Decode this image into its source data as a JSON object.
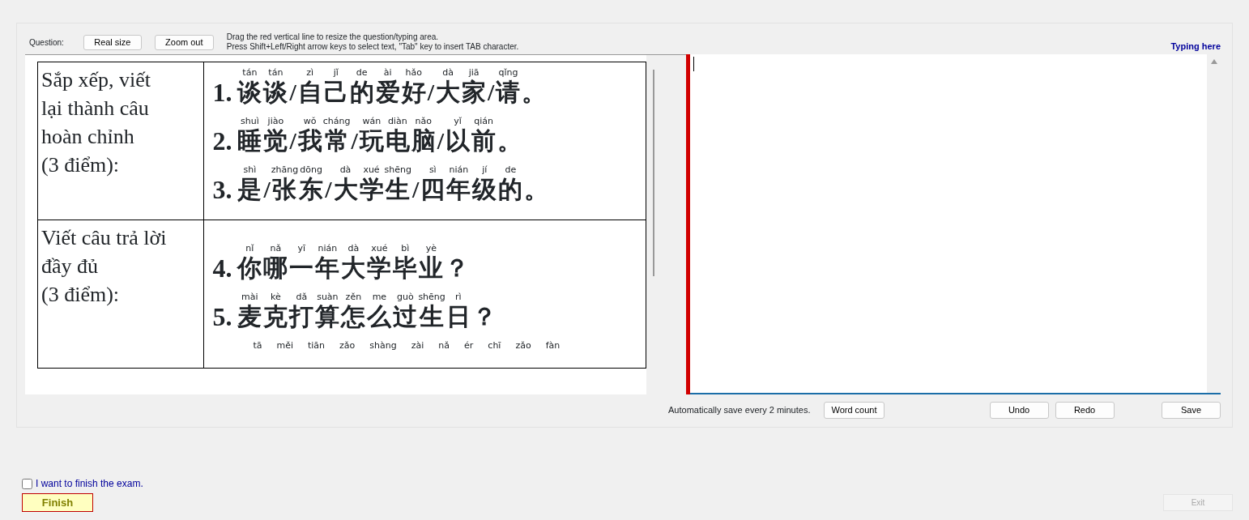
{
  "toolbar": {
    "label": "Question:",
    "buttons": [
      "Real size",
      "Zoom out"
    ],
    "hints": [
      "Drag the red vertical line to resize the question/typing area.",
      "Press Shift+Left/Right arrow keys to select text, \"Tab\" key to insert TAB character."
    ],
    "typing_label": "Typing here"
  },
  "document": {
    "rows": [
      {
        "label": "Sắp xếp, viết\nlại thành câu\nhoàn chỉnh\n(3 điểm):",
        "questions": [
          {
            "number": "1.",
            "chars": [
              {
                "py": "tán",
                "hz": "谈"
              },
              {
                "py": "tán",
                "hz": "谈"
              },
              {
                "hz": "/"
              },
              {
                "py": "zì",
                "hz": "自"
              },
              {
                "py": "jǐ",
                "hz": "己"
              },
              {
                "py": "de",
                "hz": "的"
              },
              {
                "py": "ài",
                "hz": "爱"
              },
              {
                "py": "hǎo",
                "hz": "好"
              },
              {
                "hz": "/"
              },
              {
                "py": "dà",
                "hz": "大"
              },
              {
                "py": "jiā",
                "hz": "家"
              },
              {
                "hz": "/"
              },
              {
                "py": "qǐng",
                "hz": "请"
              },
              {
                "hz": "。"
              }
            ]
          },
          {
            "number": "2.",
            "chars": [
              {
                "py": "shuì",
                "hz": "睡"
              },
              {
                "py": "jiào",
                "hz": "觉"
              },
              {
                "hz": "/"
              },
              {
                "py": "wǒ",
                "hz": "我"
              },
              {
                "py": "cháng",
                "hz": "常"
              },
              {
                "hz": "/"
              },
              {
                "py": "wán",
                "hz": "玩"
              },
              {
                "py": "diàn",
                "hz": "电"
              },
              {
                "py": "nǎo",
                "hz": "脑"
              },
              {
                "hz": "/"
              },
              {
                "py": "yǐ",
                "hz": "以"
              },
              {
                "py": "qián",
                "hz": "前"
              },
              {
                "hz": "。"
              }
            ]
          },
          {
            "number": "3.",
            "chars": [
              {
                "py": "shì",
                "hz": "是"
              },
              {
                "hz": "/"
              },
              {
                "py": "zhāng",
                "hz": "张"
              },
              {
                "py": "dōng",
                "hz": "东"
              },
              {
                "hz": "/"
              },
              {
                "py": "dà",
                "hz": "大"
              },
              {
                "py": "xué",
                "hz": "学"
              },
              {
                "py": "shēng",
                "hz": "生"
              },
              {
                "hz": "/"
              },
              {
                "py": "sì",
                "hz": "四"
              },
              {
                "py": "nián",
                "hz": "年"
              },
              {
                "py": "jí",
                "hz": "级"
              },
              {
                "py": "de",
                "hz": "的"
              },
              {
                "hz": "。"
              }
            ]
          }
        ]
      },
      {
        "label": "Viết câu trả lời\nđầy đủ\n(3 điểm):",
        "questions": [
          {
            "number": "4.",
            "chars": [
              {
                "py": "nǐ",
                "hz": "你"
              },
              {
                "py": "nǎ",
                "hz": "哪"
              },
              {
                "py": "yī",
                "hz": "一"
              },
              {
                "py": "nián",
                "hz": "年"
              },
              {
                "py": "dà",
                "hz": "大"
              },
              {
                "py": "xué",
                "hz": "学"
              },
              {
                "py": "bì",
                "hz": "毕"
              },
              {
                "py": "yè",
                "hz": "业"
              },
              {
                "hz": "？"
              }
            ]
          },
          {
            "number": "5.",
            "chars": [
              {
                "py": "mài",
                "hz": "麦"
              },
              {
                "py": "kè",
                "hz": "克"
              },
              {
                "py": "dǎ",
                "hz": "打"
              },
              {
                "py": "suàn",
                "hz": "算"
              },
              {
                "py": "zěn",
                "hz": "怎"
              },
              {
                "py": "me",
                "hz": "么"
              },
              {
                "py": "guò",
                "hz": "过"
              },
              {
                "py": "shēng",
                "hz": "生"
              },
              {
                "py": "rì",
                "hz": "日"
              },
              {
                "hz": "？"
              }
            ]
          },
          {
            "chars": [
              {
                "py": "tā"
              },
              {
                "py": "měi"
              },
              {
                "py": "tiān"
              },
              {
                "py": "zǎo"
              },
              {
                "py": "shàng"
              },
              {
                "py": "zài"
              },
              {
                "py": "nǎ"
              },
              {
                "py": "ér"
              },
              {
                "py": "chī"
              },
              {
                "py": "zǎo"
              },
              {
                "py": "fàn"
              }
            ]
          }
        ]
      }
    ]
  },
  "bottom_bar": {
    "autosave": "Automatically save every 2 minutes.",
    "word_count_button": "Word count",
    "edit_buttons": [
      "Undo",
      "Redo"
    ],
    "save_button": "Save"
  },
  "finish": {
    "checkbox": {
      "label": "I want to finish the exam.",
      "checked": false
    },
    "finish_button": "Finish",
    "exit_button": {
      "label": "Exit",
      "disabled": true
    }
  }
}
